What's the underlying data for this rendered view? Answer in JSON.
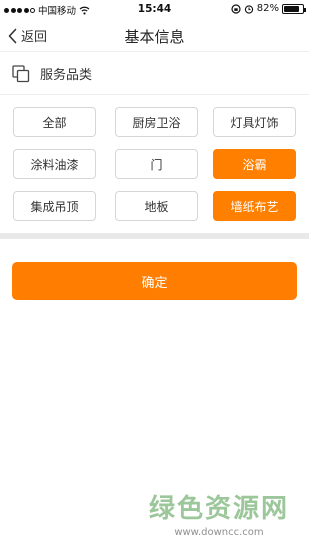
{
  "status_bar": {
    "carrier": "中国移动",
    "time": "15:44",
    "battery_percent": "82%",
    "battery_level": 0.82,
    "icons": [
      "signal-dots-icon",
      "wifi-icon",
      "lock-rotation-icon",
      "alarm-icon",
      "battery-icon"
    ]
  },
  "nav": {
    "back_label": "返回",
    "title": "基本信息",
    "back_icon": "chevron-left-icon"
  },
  "section": {
    "title": "服务品类",
    "icon": "copy-icon"
  },
  "categories": [
    {
      "label": "全部",
      "selected": false
    },
    {
      "label": "厨房卫浴",
      "selected": false
    },
    {
      "label": "灯具灯饰",
      "selected": false
    },
    {
      "label": "涂料油漆",
      "selected": false
    },
    {
      "label": "门",
      "selected": false
    },
    {
      "label": "浴霸",
      "selected": true
    },
    {
      "label": "集成吊顶",
      "selected": false
    },
    {
      "label": "地板",
      "selected": false
    },
    {
      "label": "墙纸布艺",
      "selected": true
    }
  ],
  "confirm_label": "确定",
  "colors": {
    "accent": "#ff7f00",
    "border": "#d6d6d6",
    "divider": "#e9e9e9"
  },
  "watermark": {
    "title": "绿色资源网",
    "url": "www.downcc.com"
  }
}
